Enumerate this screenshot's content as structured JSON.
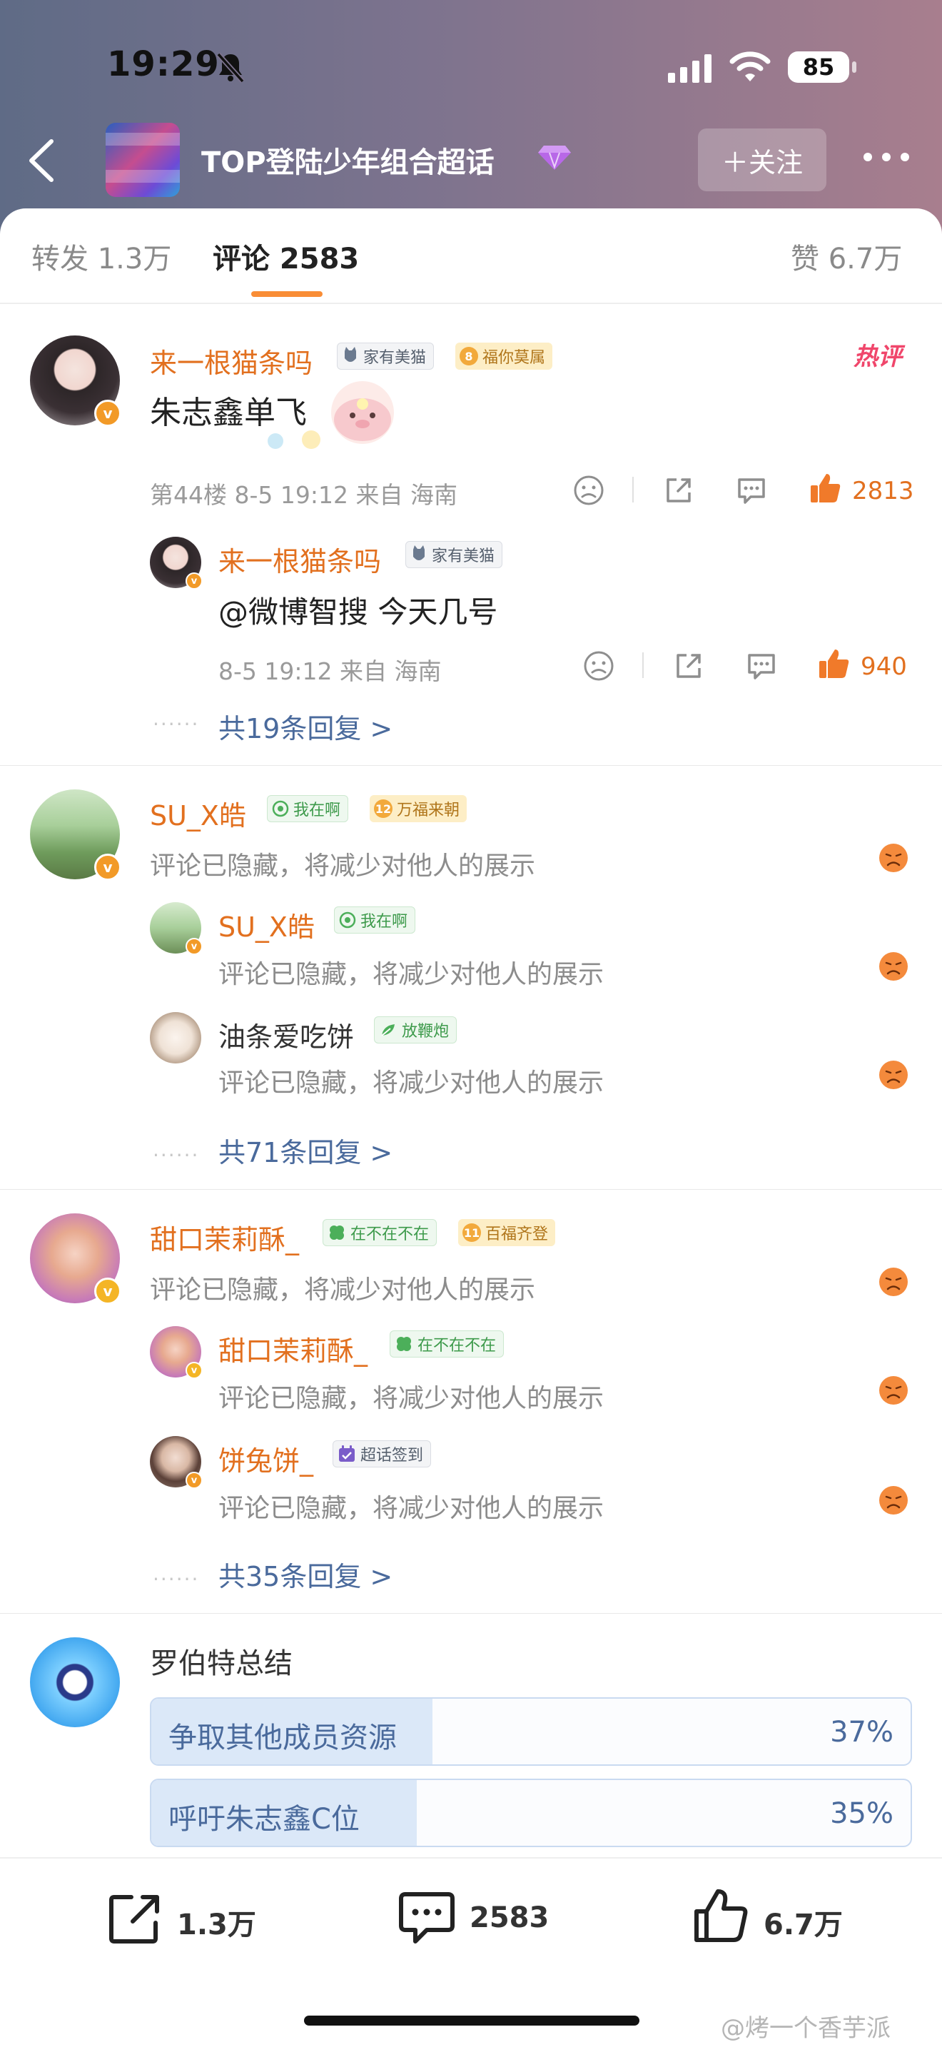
{
  "status_bar": {
    "time": "19:29",
    "battery": "85"
  },
  "nav": {
    "title": "TOP登陆少年组合超话",
    "follow_label": "＋关注"
  },
  "tabs": {
    "repost": "转发 1.3万",
    "comments": "评论 2583",
    "likes": "赞 6.7万"
  },
  "comments": [
    {
      "user": "来一根猫条吗",
      "badges": [
        "家有美猫",
        "福你莫属"
      ],
      "badge_level": "8",
      "hot_tag": "热评",
      "text": "朱志鑫单飞",
      "meta": "第44楼 8-5 19:12 来自 海南",
      "likes": "2813",
      "replies": [
        {
          "user": "来一根猫条吗",
          "badge": "家有美猫",
          "text": "@微博智搜 今天几号",
          "meta": "8-5 19:12 来自 海南",
          "likes": "940"
        }
      ],
      "more_replies": "共19条回复 >"
    },
    {
      "user": "SU_X皓",
      "badges": [
        "我在啊",
        "万福来朝"
      ],
      "badge_level": "12",
      "text": "评论已隐藏，将减少对他人的展示",
      "replies": [
        {
          "user": "SU_X皓",
          "badge": "我在啊",
          "text": "评论已隐藏，将减少对他人的展示"
        },
        {
          "user": "油条爱吃饼",
          "badge": "放鞭炮",
          "text": "评论已隐藏，将减少对他人的展示"
        }
      ],
      "more_replies": "共71条回复 >"
    },
    {
      "user": "甜口茉莉酥_",
      "badges": [
        "在不在不在",
        "百福齐登"
      ],
      "badge_level": "11",
      "text": "评论已隐藏，将减少对他人的展示",
      "replies": [
        {
          "user": "甜口茉莉酥_",
          "badge": "在不在不在",
          "text": "评论已隐藏，将减少对他人的展示"
        },
        {
          "user": "饼兔饼_",
          "badge": "超话签到",
          "text": "评论已隐藏，将减少对他人的展示"
        }
      ],
      "more_replies": "共35条回复 >"
    }
  ],
  "summary": {
    "title": "罗伯特总结",
    "options": [
      {
        "label": "争取其他成员资源",
        "percent": "37%",
        "value": 0.37
      },
      {
        "label": "呼吁朱志鑫C位",
        "percent": "35%",
        "value": 0.35
      }
    ]
  },
  "bottom_bar": {
    "repost": "1.3万",
    "comments": "2583",
    "likes": "6.7万"
  },
  "watermark": "@烤一个香芋派",
  "colors": {
    "accent": "#e2701f",
    "link": "#4a6a9c",
    "tab_underline": "#f98d36",
    "hot_tag": "#f0466b"
  }
}
